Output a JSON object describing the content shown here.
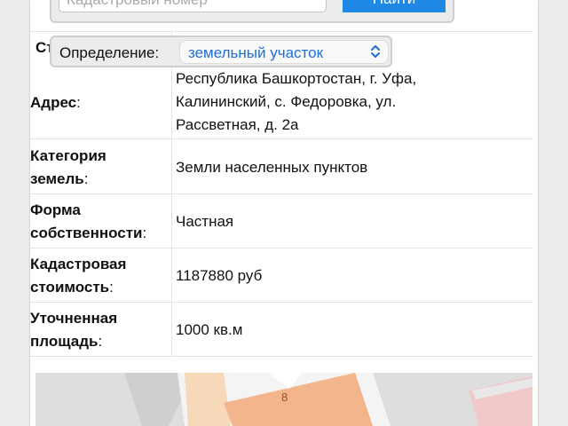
{
  "search": {
    "placeholder": "Кадастровый номер",
    "button_label": "Найти"
  },
  "definition": {
    "label": "Определение:",
    "selected": "земельный участок"
  },
  "table": {
    "partial_label": "Ст",
    "rows": [
      {
        "label": "Адрес",
        "colon": ":",
        "value_lines": [
          "Республика Башкортостан, г. Уфа,",
          "Калининский, с. Федоровка, ул.",
          "Рассветная, д. 2а"
        ]
      },
      {
        "label_lines": [
          "Категория",
          "земель"
        ],
        "colon": ":",
        "value": "Земли населенных пунктов"
      },
      {
        "label_lines": [
          "Форма",
          "собственности"
        ],
        "colon": ":",
        "value": "Частная"
      },
      {
        "label_lines": [
          "Кадастровая",
          "стоимость"
        ],
        "colon": ":",
        "value": "1187880 руб"
      },
      {
        "label_lines": [
          "Уточненная",
          "площадь"
        ],
        "colon": ":",
        "value": "1000 кв.м"
      }
    ]
  },
  "map": {
    "plot_number": "8",
    "plot_color": "#f3b58c",
    "marker_color": "#ffffff"
  },
  "colors": {
    "accent": "#1e88e5",
    "select_text": "#1e6fd9"
  }
}
